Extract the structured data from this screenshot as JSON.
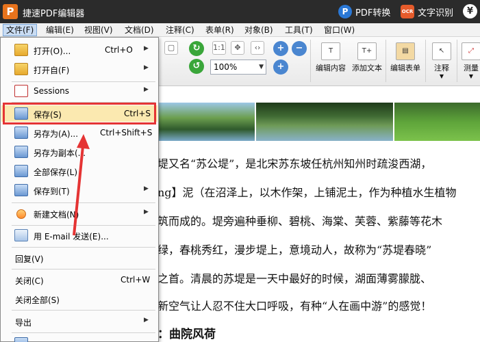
{
  "app": {
    "title": "捷速PDF编辑器",
    "logo_letter": "P",
    "pdf_convert": "PDF转换",
    "pdf_icon_letter": "P",
    "ocr_badge": "OCR",
    "ocr": "文字识别",
    "yen": "¥"
  },
  "menubar": [
    "文件(F)",
    "编辑(E)",
    "视图(V)",
    "文档(D)",
    "注释(C)",
    "表单(R)",
    "对象(B)",
    "工具(T)",
    "窗口(W)"
  ],
  "toolbar": {
    "zoom": "100%",
    "edit_content": "编辑内容",
    "add_text": "添加文本",
    "edit_form": "编辑表单",
    "annotate": "注释",
    "measure": "测量"
  },
  "file_menu": {
    "open": {
      "label": "打开(O)...",
      "shortcut": "Ctrl+O"
    },
    "open_from": {
      "label": "打开自(F)"
    },
    "sessions": {
      "label": "Sessions"
    },
    "save": {
      "label": "保存(S)",
      "shortcut": "Ctrl+S"
    },
    "save_as": {
      "label": "另存为(A)...",
      "shortcut": "Ctrl+Shift+S"
    },
    "save_copy": {
      "label": "另存为副本(..."
    },
    "save_all": {
      "label": "全部保存(L)"
    },
    "save_to": {
      "label": "保存到(T)"
    },
    "new_doc": {
      "label": "新建文档(N)"
    },
    "email": {
      "label": "用 E-mail 发送(E)..."
    },
    "revert": {
      "label": "回复(V)"
    },
    "close": {
      "label": "关闭(C)",
      "shortcut": "Ctrl+W"
    },
    "close_all": {
      "label": "关闭全部(S)"
    },
    "export": {
      "label": "导出"
    }
  },
  "document": {
    "lines": [
      "堤又名“苏公堤”，是北宋苏东坡任杭州知州时疏浚西湖，",
      "ng】泥（在沼泽上，以木作架，上铺泥土，作为种植水生植物",
      "筑而成的。堤旁遍种垂柳、碧桃、海棠、芙蓉、紫藤等花木",
      "绿，春桃秀红，漫步堤上，意境动人，故称为“苏堤春晓”",
      "之首。清晨的苏堤是一天中最好的时候，湖面薄雾朦胧、",
      "新空气让人忍不住大口呼吸，有种“人在画中游”的感觉！"
    ],
    "heading": "：曲院风荷"
  }
}
